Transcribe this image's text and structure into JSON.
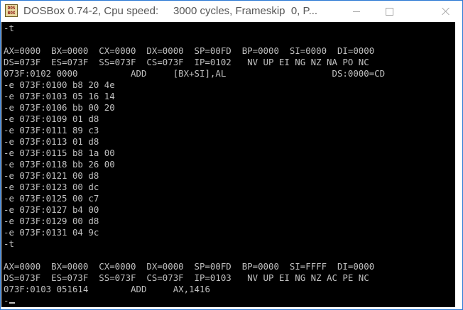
{
  "window": {
    "title": "DOSBox 0.74-2, Cpu speed:     3000 cycles, Frameskip  0, P...",
    "icon_label": "DOS BOX",
    "controls": {
      "minimize": "minimize-icon",
      "maximize": "maximize-icon",
      "close": "close-icon"
    }
  },
  "console": {
    "foreground": "#c0c0c0",
    "background": "#000000",
    "lines": [
      "-t",
      "",
      "AX=0000  BX=0000  CX=0000  DX=0000  SP=00FD  BP=0000  SI=0000  DI=0000",
      "DS=073F  ES=073F  SS=073F  CS=073F  IP=0102   NV UP EI NG NZ NA PO NC",
      "073F:0102 0000          ADD     [BX+SI],AL                    DS:0000=CD",
      "-e 073F:0100 b8 20 4e",
      "-e 073F:0103 05 16 14",
      "-e 073F:0106 bb 00 20",
      "-e 073F:0109 01 d8",
      "-e 073F:0111 89 c3",
      "-e 073F:0113 01 d8",
      "-e 073F:0115 b8 1a 00",
      "-e 073F:0118 bb 26 00",
      "-e 073F:0121 00 d8",
      "-e 073F:0123 00 dc",
      "-e 073F:0125 00 c7",
      "-e 073F:0127 b4 00",
      "-e 073F:0129 00 d8",
      "-e 073F:0131 04 9c",
      "-t",
      "",
      "AX=0000  BX=0000  CX=0000  DX=0000  SP=00FD  BP=0000  SI=FFFF  DI=0000",
      "DS=073F  ES=073F  SS=073F  CS=073F  IP=0103   NV UP EI NG NZ AC PE NC",
      "073F:0103 051614        ADD     AX,1416",
      "-"
    ]
  }
}
